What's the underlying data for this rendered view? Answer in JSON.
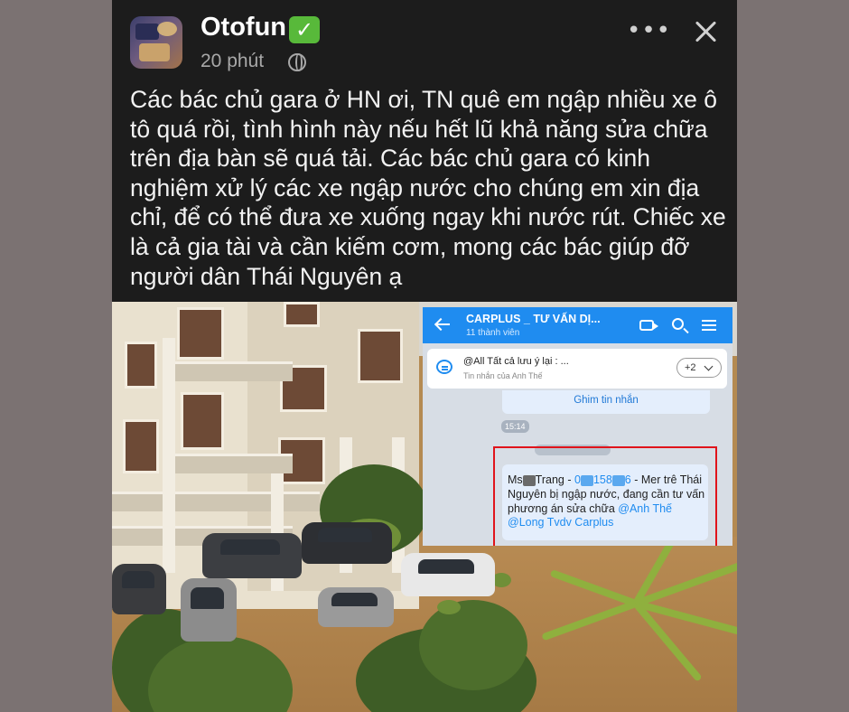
{
  "post": {
    "author": "Otofun",
    "verified_badge": "✓",
    "time": "20 phút",
    "more_label": "•••",
    "body": "Các bác chủ gara ở HN ơi, TN quê em ngập nhiều xe ô tô quá rồi, tình hình này nếu hết lũ khả năng sửa chữa trên địa bàn sẽ quá tải. Các bác chủ gara có kinh nghiệm xử lý các xe ngập nước cho chúng em xin địa chỉ, để có thể đưa xe xuống ngay khi nước rút. Chiếc xe là cả gia tài và cần kiếm cơm, mong các bác giúp đỡ người dân Thái Nguyên ạ"
  },
  "chat": {
    "group_name": "CARPLUS _ TƯ VẤN DỊ...",
    "members": "11 thành viên",
    "pinned_title": "@All  Tất cả lưu ý lại : ...",
    "pinned_sub": "Tin nhắn của Anh Thế",
    "pinned_more": "+2",
    "pin_action": "Ghim tin nhắn",
    "timestamp": "15:14",
    "msg_part1": "Ms",
    "msg_part2": "Trang - ",
    "msg_phone1": "0",
    "msg_phone2": "158",
    "msg_phone3": "6",
    "msg_part3": " - Mer trê Thái Nguyên bị ngập nước, đang cần tư vấn phương án sửa chữa ",
    "msg_mention1": "@Anh Thế",
    "msg_mention2": "@Long Tvdv Carplus"
  },
  "colors": {
    "background": "#7b7272",
    "post_bg": "#1c1c1c",
    "chat_header": "#1f8cf0",
    "highlight_border": "#e0141b",
    "verified": "#58b93a"
  }
}
